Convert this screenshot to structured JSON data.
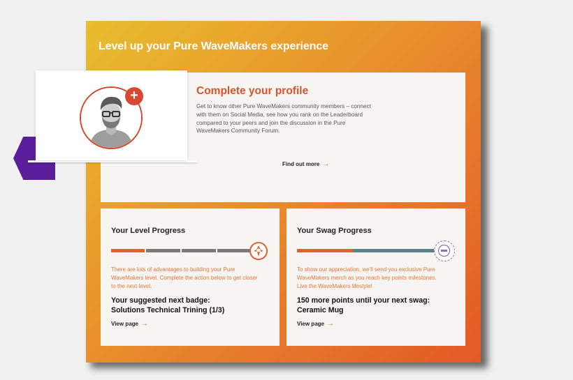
{
  "header": {
    "title": "Level up your Pure WaveMakers experience"
  },
  "profile": {
    "title": "Complete your profile",
    "description": "Get to know other Pure WaveMakers community members – connect with them on Social Media, see how you rank on the Leaderboard compared to your peers and join the discussion in the Pure WaveMakers Community Forum.",
    "link": "Find out more",
    "badge_symbol": "+"
  },
  "level": {
    "title": "Your Level Progress",
    "progress_segments_filled": 1,
    "progress_segments_total": 4,
    "description": "There are lots of advantages to building your Pure WaveMakers level. Complete the action below to get closer to the next level.",
    "badge_label": "Your suggested next badge:",
    "badge_name": "Solutions Technical Trining (1/3)",
    "link": "View page"
  },
  "swag": {
    "title": "Your Swag Progress",
    "progress": 0.4,
    "description": "To show our appreciation, we'll send you exclusive Pure WaveMakers merch as you reach key points milestones. Live the WaveMakers lifestyle!",
    "points_label": "150 more points until your next swag:",
    "item_name": "Ceramic Mug",
    "link": "View page"
  },
  "icons": {
    "arrow": "→",
    "profile_icon": "person-avatar-icon",
    "level_icon": "level-badge-icon",
    "swag_icon": "swag-badge-icon"
  },
  "colors": {
    "accent": "#d9542c",
    "purple": "#5b1e9b",
    "bar_orange": "#e0602f",
    "bar_gray": "#7a7a7a",
    "swag_bar_gray": "#5f7f8c"
  }
}
